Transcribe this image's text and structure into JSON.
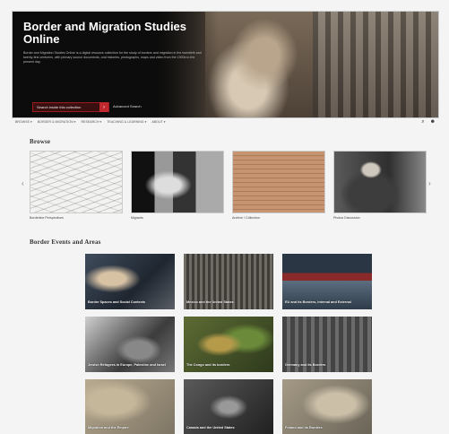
{
  "hero": {
    "title": "Border and Migration Studies Online",
    "description": "Border and Migration Studies Online is a digital resource collection for the study of borders and migration in the twentieth and twenty-first centuries, with primary source documents, oral histories, photographs, maps and video from the 1900s to the present day.",
    "search_label": "Search inside this collection",
    "advanced_label": "Advanced Search"
  },
  "nav": {
    "items": [
      "Browse ▾",
      "Border & Migration ▾",
      "Research ▾",
      "Teaching & Learning ▾",
      "About ▾"
    ]
  },
  "browse": {
    "title": "Browse",
    "cards": [
      {
        "caption": "Borderline Perspectives"
      },
      {
        "caption": "Migrants"
      },
      {
        "caption": "Archive / Collection"
      },
      {
        "caption": "Photos Discussion"
      }
    ]
  },
  "events": {
    "title": "Border Events and Areas",
    "tiles": [
      {
        "label": "Border Spaces and Social Contexts"
      },
      {
        "label": "Mexico and the United States"
      },
      {
        "label": "EU and its Borders, Internal and External"
      },
      {
        "label": "Jewish Refugees in Europe, Palestine and Israel"
      },
      {
        "label": "The Congo and its borders"
      },
      {
        "label": "Germany and its Borders"
      },
      {
        "label": "Migration and the Empire"
      },
      {
        "label": "Canada and the United States"
      },
      {
        "label": "Poland and its Borders"
      }
    ]
  }
}
